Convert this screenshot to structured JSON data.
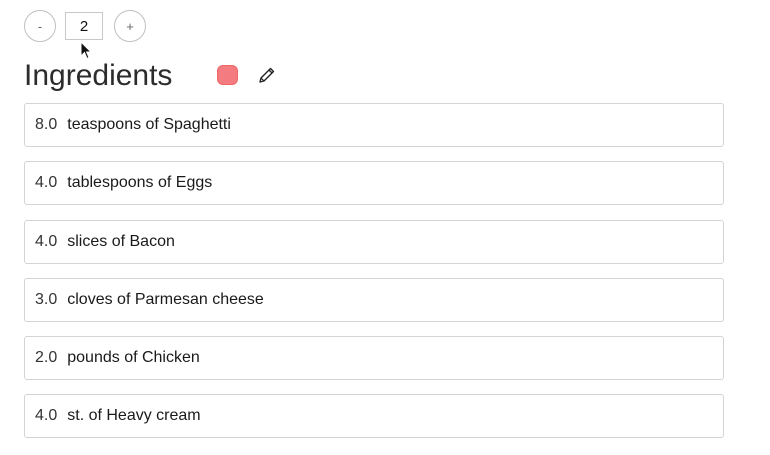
{
  "servings": {
    "decrement_label": "-",
    "count": "2",
    "increment_label": "+"
  },
  "header": {
    "title": "Ingredients",
    "swatch_color": "#f47c80"
  },
  "ingredients": [
    {
      "qty": "8.0",
      "text": "teaspoons of Spaghetti"
    },
    {
      "qty": "4.0",
      "text": "tablespoons of Eggs"
    },
    {
      "qty": "4.0",
      "text": "slices of Bacon"
    },
    {
      "qty": "3.0",
      "text": "cloves of Parmesan cheese"
    },
    {
      "qty": "2.0",
      "text": "pounds of Chicken"
    },
    {
      "qty": "4.0",
      "text": "st. of Heavy cream"
    }
  ]
}
